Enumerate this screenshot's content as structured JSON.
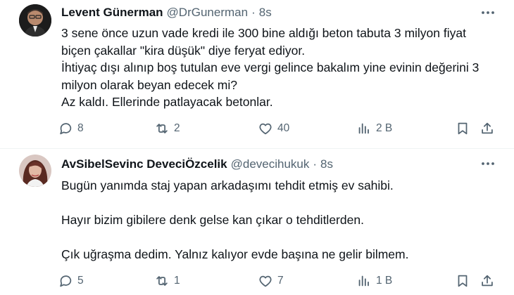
{
  "tweets": [
    {
      "display_name": "Levent Günerman",
      "handle": "@DrGunerman",
      "separator": "·",
      "time": "8s",
      "paragraphs": [
        "3 sene önce uzun vade kredi ile 300 bine aldığı beton tabuta 3 milyon fiyat\nbiçen çakallar \"kira düşük\" diye feryat ediyor.\nİhtiyaç dışı alınıp boş tutulan eve vergi gelince bakalım yine evinin değerini 3\nmilyon olarak beyan edecek mi?\nAz kaldı. Ellerinde patlayacak betonlar."
      ],
      "stats": {
        "replies": "8",
        "reposts": "2",
        "likes": "40",
        "views": "2 B"
      }
    },
    {
      "display_name": "AvSibelSevinc DeveciÖzcelik",
      "handle": "@devecihukuk",
      "separator": "·",
      "time": "8s",
      "paragraphs": [
        "Bugün yanımda staj yapan arkadaşımı tehdit etmiş ev sahibi.",
        "Hayır bizim gibilere denk gelse kan çıkar o tehditlerden.",
        "Çık uğraşma dedim. Yalnız kalıyor evde başına ne gelir bilmem."
      ],
      "stats": {
        "replies": "5",
        "reposts": "1",
        "likes": "7",
        "views": "1 B"
      }
    }
  ],
  "icons": {
    "reply": "reply-icon",
    "repost": "repost-icon",
    "like": "heart-icon",
    "views": "views-icon",
    "bookmark": "bookmark-icon",
    "share": "share-icon",
    "more": "more-icon"
  },
  "colors": {
    "text": "#0f1419",
    "secondary": "#536471",
    "divider": "#eff3f4"
  }
}
